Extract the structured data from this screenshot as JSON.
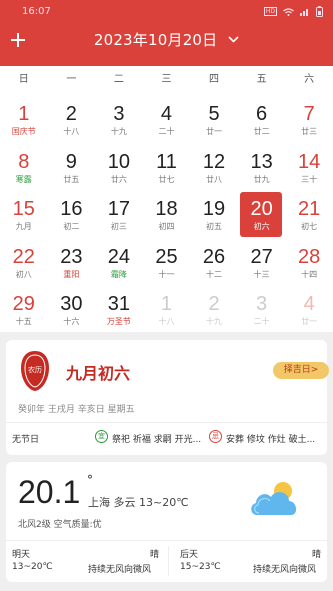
{
  "status_bar": {
    "time": "16:07",
    "hd": "HD"
  },
  "header": {
    "title": "2023年10月20日",
    "add_icon": "plus-icon",
    "chevron_icon": "chevron-down-icon",
    "color": "#d9413a"
  },
  "weekdays": [
    "日",
    "一",
    "二",
    "三",
    "四",
    "五",
    "六"
  ],
  "calendar": {
    "selected_day": "20",
    "rows": [
      [
        {
          "day": "1",
          "sub": "国庆节",
          "kind": "festival"
        },
        {
          "day": "2",
          "sub": "十八"
        },
        {
          "day": "3",
          "sub": "十九"
        },
        {
          "day": "4",
          "sub": "二十"
        },
        {
          "day": "5",
          "sub": "廿一"
        },
        {
          "day": "6",
          "sub": "廿二"
        },
        {
          "day": "7",
          "sub": "廿三"
        }
      ],
      [
        {
          "day": "8",
          "sub": "寒露",
          "kind": "term"
        },
        {
          "day": "9",
          "sub": "廿五"
        },
        {
          "day": "10",
          "sub": "廿六"
        },
        {
          "day": "11",
          "sub": "廿七"
        },
        {
          "day": "12",
          "sub": "廿八"
        },
        {
          "day": "13",
          "sub": "廿九"
        },
        {
          "day": "14",
          "sub": "三十"
        }
      ],
      [
        {
          "day": "15",
          "sub": "九月"
        },
        {
          "day": "16",
          "sub": "初二"
        },
        {
          "day": "17",
          "sub": "初三"
        },
        {
          "day": "18",
          "sub": "初四"
        },
        {
          "day": "19",
          "sub": "初五"
        },
        {
          "day": "20",
          "sub": "初六",
          "selected": true
        },
        {
          "day": "21",
          "sub": "初七"
        }
      ],
      [
        {
          "day": "22",
          "sub": "初八"
        },
        {
          "day": "23",
          "sub": "重阳",
          "kind": "festival"
        },
        {
          "day": "24",
          "sub": "霜降",
          "kind": "term"
        },
        {
          "day": "25",
          "sub": "十一"
        },
        {
          "day": "26",
          "sub": "十二"
        },
        {
          "day": "27",
          "sub": "十三"
        },
        {
          "day": "28",
          "sub": "十四"
        }
      ],
      [
        {
          "day": "29",
          "sub": "十五"
        },
        {
          "day": "30",
          "sub": "十六"
        },
        {
          "day": "31",
          "sub": "万圣节",
          "kind": "festival"
        },
        {
          "day": "1",
          "sub": "十八",
          "faded": true
        },
        {
          "day": "2",
          "sub": "十九",
          "faded": true
        },
        {
          "day": "3",
          "sub": "二十",
          "faded": true
        },
        {
          "day": "4",
          "sub": "廿一",
          "faded": true
        }
      ]
    ]
  },
  "almanac": {
    "lunar_date": "九月初六",
    "seal_text": "农历",
    "pick_day_button": "择吉日>",
    "ganzhi": "癸卯年 王戌月 辛亥日 星期五",
    "festival": "无节日",
    "yi_badge": "宜",
    "yi": "祭祀 祈福 求嗣 开光...",
    "ji_badge": "忌",
    "ji": "安葬 修坟 作灶 破土..."
  },
  "weather": {
    "temp": "20.1",
    "degree": "°",
    "now": "上海 多云 13~20℃",
    "air": "北风2级 空气质量:优",
    "icon": "partly-cloudy-icon",
    "today_label": "明天",
    "today_cond": "晴",
    "today_range": "13~20℃",
    "today_wind": "持续无风向微风",
    "tomorrow_label": "后天",
    "tomorrow_cond": "晴",
    "tomorrow_range": "15~23℃",
    "tomorrow_wind": "持续无风向微风"
  }
}
